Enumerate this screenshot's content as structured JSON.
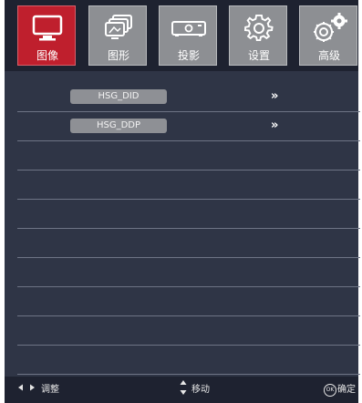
{
  "tabs": [
    {
      "label": "图像",
      "icon": "monitor-icon",
      "active": true
    },
    {
      "label": "图形",
      "icon": "stacked-screens-icon",
      "active": false
    },
    {
      "label": "投影",
      "icon": "projector-icon",
      "active": false
    },
    {
      "label": "设置",
      "icon": "gear-icon",
      "active": false
    },
    {
      "label": "高级",
      "icon": "advanced-gears-icon",
      "active": false
    }
  ],
  "menu": {
    "items": [
      {
        "label": "HSG_DID",
        "arrow": "»"
      },
      {
        "label": "HSG_DDP",
        "arrow": "»"
      }
    ]
  },
  "footer": {
    "adjust": {
      "icon": "left-right-arrows-icon",
      "label": "调整"
    },
    "move": {
      "icon": "up-down-arrows-icon",
      "label": "移动"
    },
    "confirm": {
      "icon": "ok-button-icon",
      "badge": "OK",
      "label": "确定"
    }
  },
  "colors": {
    "active_tab": "#bf1f2d",
    "inactive_tab": "#8d8f93",
    "panel": "#2f3546",
    "bar": "#1e2230"
  }
}
